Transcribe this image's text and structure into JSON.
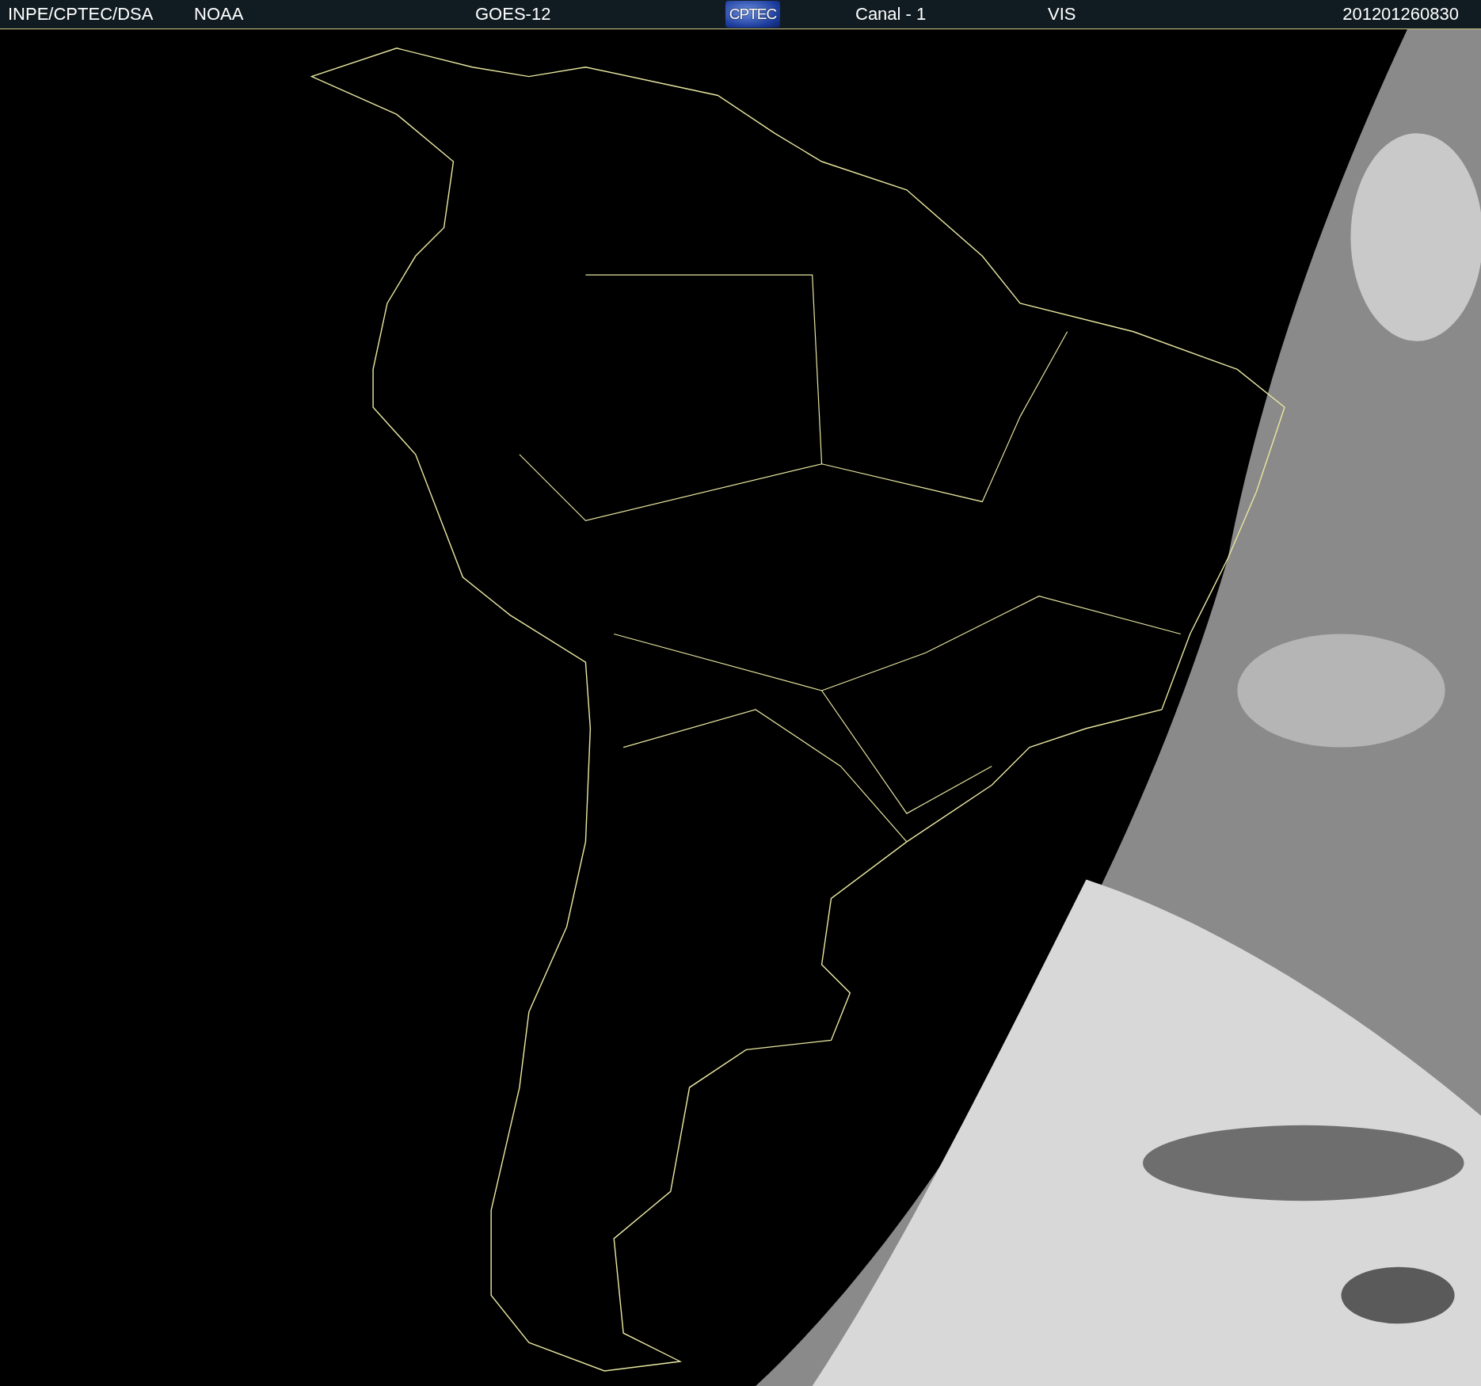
{
  "header": {
    "items": [
      {
        "kind": "text",
        "text": "INPE/CPTEC/DSA"
      },
      {
        "kind": "text",
        "text": "NOAA"
      },
      {
        "kind": "text",
        "text": "GOES-12"
      },
      {
        "kind": "logo",
        "text": "CPTEC"
      },
      {
        "kind": "text",
        "text": "Canal - 1"
      },
      {
        "kind": "text",
        "text": "VIS"
      },
      {
        "kind": "text",
        "text": "201201260830"
      }
    ]
  }
}
